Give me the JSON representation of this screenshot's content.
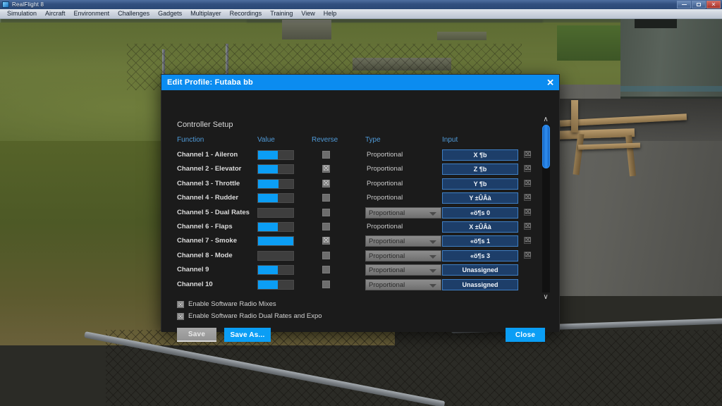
{
  "window": {
    "app_title": "RealFlight 8",
    "controls": {
      "minimize": "minimize-button",
      "maximize": "maximize-button",
      "close": "close-button"
    }
  },
  "menubar": {
    "items": [
      {
        "label": "Simulation"
      },
      {
        "label": "Aircraft"
      },
      {
        "label": "Environment"
      },
      {
        "label": "Challenges"
      },
      {
        "label": "Gadgets"
      },
      {
        "label": "Multiplayer"
      },
      {
        "label": "Recordings"
      },
      {
        "label": "Training"
      },
      {
        "label": "View"
      },
      {
        "label": "Help"
      }
    ]
  },
  "dialog": {
    "title": "Edit Profile: Futaba bb",
    "close_glyph": "✕",
    "section_title": "Controller Setup",
    "columns": {
      "function": "Function",
      "value": "Value",
      "reverse": "Reverse",
      "type": "Type",
      "input": "Input"
    },
    "rows": [
      {
        "name": "Channel 1 - Aileron",
        "value_pct": 55,
        "reverse": false,
        "type": "Proportional",
        "type_dropdown": false,
        "input": "X ¶b",
        "clearable": true
      },
      {
        "name": "Channel 2 - Elevator",
        "value_pct": 55,
        "reverse": true,
        "type": "Proportional",
        "type_dropdown": false,
        "input": "Z ¶b",
        "clearable": true
      },
      {
        "name": "Channel 3 - Throttle",
        "value_pct": 57,
        "reverse": true,
        "type": "Proportional",
        "type_dropdown": false,
        "input": "Y ¶b",
        "clearable": true
      },
      {
        "name": "Channel 4 - Rudder",
        "value_pct": 55,
        "reverse": false,
        "type": "Proportional",
        "type_dropdown": false,
        "input": "Y ±ÛÂà",
        "clearable": true
      },
      {
        "name": "Channel 5 - Dual Rates",
        "value_pct": 0,
        "reverse": false,
        "type": "Proportional",
        "type_dropdown": true,
        "input": "«ö¶s 0",
        "clearable": true
      },
      {
        "name": "Channel 6 - Flaps",
        "value_pct": 55,
        "reverse": false,
        "type": "Proportional",
        "type_dropdown": false,
        "input": "X ±ÛÂà",
        "clearable": true
      },
      {
        "name": "Channel 7 - Smoke",
        "value_pct": 100,
        "reverse": true,
        "type": "Proportional",
        "type_dropdown": true,
        "input": "«ö¶s 1",
        "clearable": true
      },
      {
        "name": "Channel 8 - Mode",
        "value_pct": 0,
        "reverse": false,
        "type": "Proportional",
        "type_dropdown": true,
        "input": "«ö¶s 3",
        "clearable": true
      },
      {
        "name": "Channel 9",
        "value_pct": 55,
        "reverse": false,
        "type": "Proportional",
        "type_dropdown": true,
        "input": "Unassigned",
        "clearable": false
      },
      {
        "name": "Channel 10",
        "value_pct": 55,
        "reverse": false,
        "type": "Proportional",
        "type_dropdown": true,
        "input": "Unassigned",
        "clearable": false
      }
    ],
    "checkbox_glyph": "☒",
    "scrollbar": {
      "up_glyph": "∧",
      "down_glyph": "∨",
      "thumb_pos_pct": 0
    },
    "options": [
      {
        "label": "Enable Software Radio Mixes",
        "checked": true
      },
      {
        "label": "Enable Software Radio Dual Rates and Expo",
        "checked": true
      }
    ],
    "buttons": {
      "save": "Save",
      "save_as": "Save As...",
      "close": "Close"
    },
    "clear_glyph": "⌧"
  },
  "colors": {
    "accent_blue": "#0b9ef5",
    "title_blue": "#0b8cf0",
    "header_text_blue": "#4f9ad8",
    "input_bg": "#1d3e69",
    "input_border": "#3f7fc4",
    "dialog_bg": "#1b1b1b"
  }
}
